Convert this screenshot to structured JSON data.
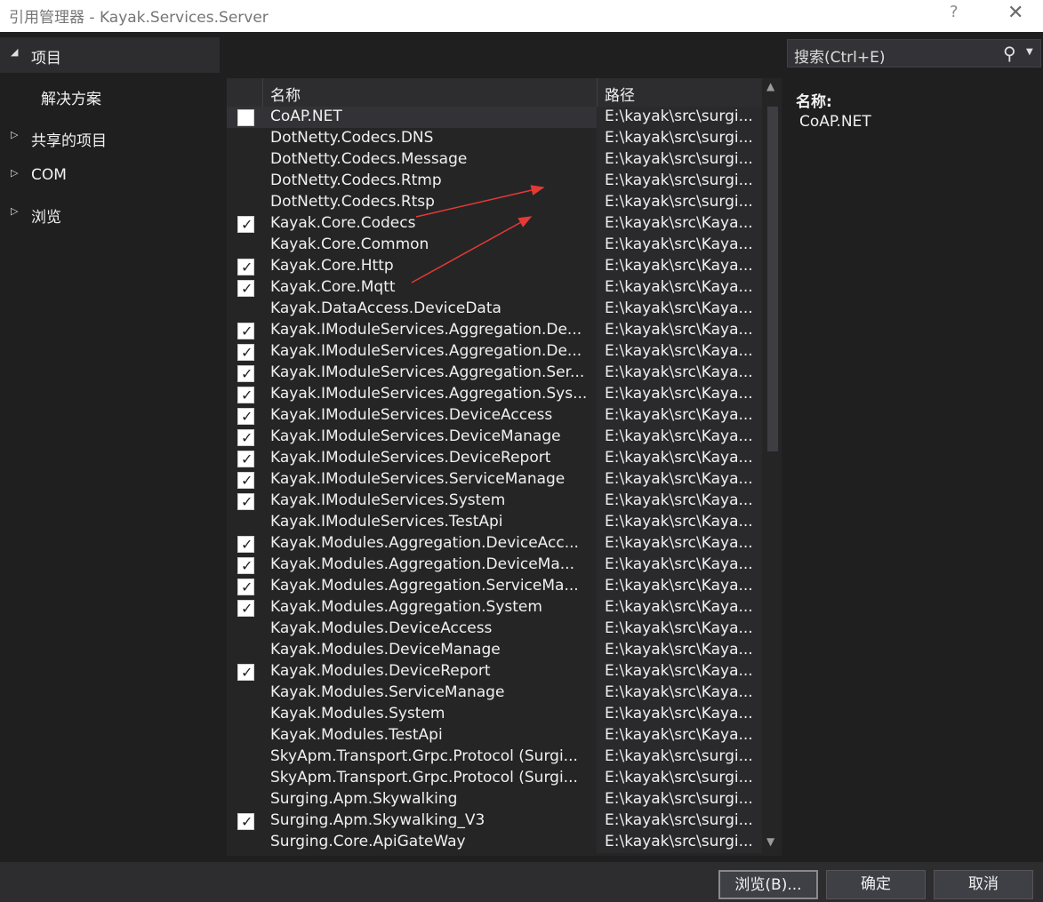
{
  "window": {
    "title": "引用管理器 - Kayak.Services.Server",
    "help_glyph": "?",
    "close_glyph": "✕"
  },
  "nav": {
    "items": [
      {
        "label": "项目",
        "arrow": "◢",
        "selected": true
      },
      {
        "label": "解决方案",
        "arrow": "",
        "selected": false
      },
      {
        "label": "共享的项目",
        "arrow": "▷",
        "selected": false
      },
      {
        "label": "COM",
        "arrow": "▷",
        "selected": false
      },
      {
        "label": "浏览",
        "arrow": "▷",
        "selected": false
      }
    ]
  },
  "search": {
    "placeholder": "搜索(Ctrl+E)",
    "icon": "search-icon"
  },
  "list": {
    "col_name": "名称",
    "col_path": "路径",
    "rows": [
      {
        "name": "CoAP.NET",
        "path": "E:\\kayak\\src\\surgi...",
        "checked": false,
        "box": true,
        "selected": true
      },
      {
        "name": "DotNetty.Codecs.DNS",
        "path": "E:\\kayak\\src\\surgi...",
        "checked": false
      },
      {
        "name": "DotNetty.Codecs.Message",
        "path": "E:\\kayak\\src\\surgi...",
        "checked": false
      },
      {
        "name": "DotNetty.Codecs.Rtmp",
        "path": "E:\\kayak\\src\\surgi...",
        "checked": false
      },
      {
        "name": "DotNetty.Codecs.Rtsp",
        "path": "E:\\kayak\\src\\surgi...",
        "checked": false
      },
      {
        "name": "Kayak.Core.Codecs",
        "path": "E:\\kayak\\src\\Kaya...",
        "checked": true
      },
      {
        "name": "Kayak.Core.Common",
        "path": "E:\\kayak\\src\\Kaya...",
        "checked": false
      },
      {
        "name": "Kayak.Core.Http",
        "path": "E:\\kayak\\src\\Kaya...",
        "checked": true
      },
      {
        "name": "Kayak.Core.Mqtt",
        "path": "E:\\kayak\\src\\Kaya...",
        "checked": true
      },
      {
        "name": "Kayak.DataAccess.DeviceData",
        "path": "E:\\kayak\\src\\Kaya...",
        "checked": false
      },
      {
        "name": "Kayak.IModuleServices.Aggregation.De...",
        "path": "E:\\kayak\\src\\Kaya...",
        "checked": true
      },
      {
        "name": "Kayak.IModuleServices.Aggregation.De...",
        "path": "E:\\kayak\\src\\Kaya...",
        "checked": true
      },
      {
        "name": "Kayak.IModuleServices.Aggregation.Ser...",
        "path": "E:\\kayak\\src\\Kaya...",
        "checked": true
      },
      {
        "name": "Kayak.IModuleServices.Aggregation.Sys...",
        "path": "E:\\kayak\\src\\Kaya...",
        "checked": true
      },
      {
        "name": "Kayak.IModuleServices.DeviceAccess",
        "path": "E:\\kayak\\src\\Kaya...",
        "checked": true
      },
      {
        "name": "Kayak.IModuleServices.DeviceManage",
        "path": "E:\\kayak\\src\\Kaya...",
        "checked": true
      },
      {
        "name": "Kayak.IModuleServices.DeviceReport",
        "path": "E:\\kayak\\src\\Kaya...",
        "checked": true
      },
      {
        "name": "Kayak.IModuleServices.ServiceManage",
        "path": "E:\\kayak\\src\\Kaya...",
        "checked": true
      },
      {
        "name": "Kayak.IModuleServices.System",
        "path": "E:\\kayak\\src\\Kaya...",
        "checked": true
      },
      {
        "name": "Kayak.IModuleServices.TestApi",
        "path": "E:\\kayak\\src\\Kaya...",
        "checked": false
      },
      {
        "name": "Kayak.Modules.Aggregation.DeviceAcc...",
        "path": "E:\\kayak\\src\\Kaya...",
        "checked": true
      },
      {
        "name": "Kayak.Modules.Aggregation.DeviceMa...",
        "path": "E:\\kayak\\src\\Kaya...",
        "checked": true
      },
      {
        "name": "Kayak.Modules.Aggregation.ServiceMa...",
        "path": "E:\\kayak\\src\\Kaya...",
        "checked": true
      },
      {
        "name": "Kayak.Modules.Aggregation.System",
        "path": "E:\\kayak\\src\\Kaya...",
        "checked": true
      },
      {
        "name": "Kayak.Modules.DeviceAccess",
        "path": "E:\\kayak\\src\\Kaya...",
        "checked": false
      },
      {
        "name": "Kayak.Modules.DeviceManage",
        "path": "E:\\kayak\\src\\Kaya...",
        "checked": false
      },
      {
        "name": "Kayak.Modules.DeviceReport",
        "path": "E:\\kayak\\src\\Kaya...",
        "checked": true
      },
      {
        "name": "Kayak.Modules.ServiceManage",
        "path": "E:\\kayak\\src\\Kaya...",
        "checked": false
      },
      {
        "name": "Kayak.Modules.System",
        "path": "E:\\kayak\\src\\Kaya...",
        "checked": false
      },
      {
        "name": "Kayak.Modules.TestApi",
        "path": "E:\\kayak\\src\\Kaya...",
        "checked": false
      },
      {
        "name": "SkyApm.Transport.Grpc.Protocol (Surgi...",
        "path": "E:\\kayak\\src\\surgi...",
        "checked": false
      },
      {
        "name": "SkyApm.Transport.Grpc.Protocol (Surgi...",
        "path": "E:\\kayak\\src\\surgi...",
        "checked": false
      },
      {
        "name": "Surging.Apm.Skywalking",
        "path": "E:\\kayak\\src\\surgi...",
        "checked": false
      },
      {
        "name": "Surging.Apm.Skywalking_V3",
        "path": "E:\\kayak\\src\\surgi...",
        "checked": true
      },
      {
        "name": "Surging.Core.ApiGateWay",
        "path": "E:\\kayak\\src\\surgi...",
        "checked": false
      }
    ]
  },
  "details": {
    "name_label": "名称:",
    "name_value": "CoAP.NET"
  },
  "buttons": {
    "browse": "浏览(B)...",
    "ok": "确定",
    "cancel": "取消"
  },
  "colors": {
    "annotation_arrow": "#e53935",
    "background": "#1f1f1f",
    "list_background": "#252526"
  }
}
